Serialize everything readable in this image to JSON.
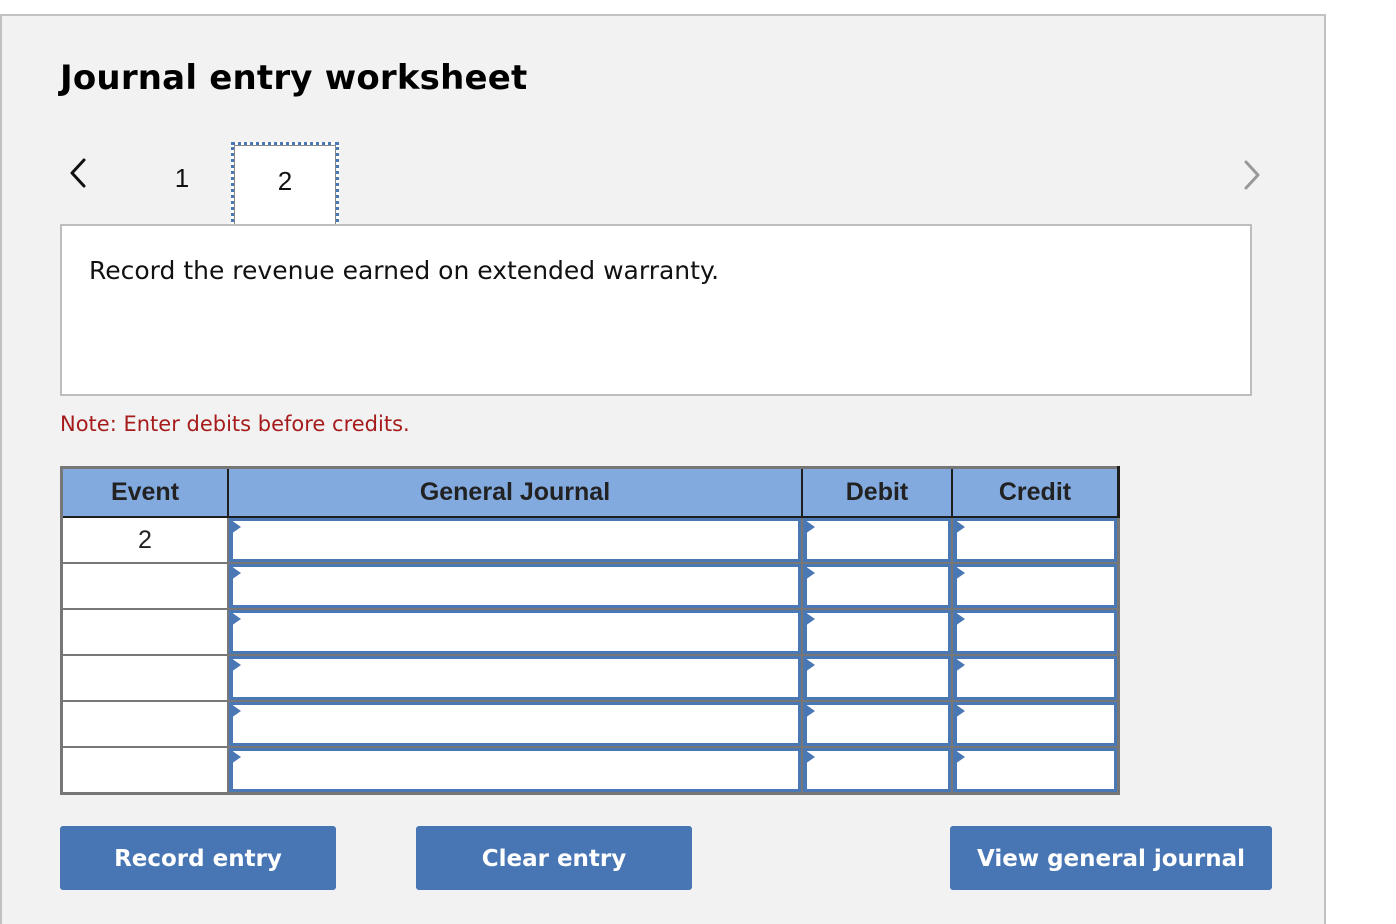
{
  "worksheet": {
    "title": "Journal entry worksheet",
    "nav": {
      "prev_icon": "chevron-left-icon",
      "next_icon": "chevron-right-icon",
      "pages": [
        {
          "label": "1",
          "active": false
        },
        {
          "label": "2",
          "active": true
        }
      ]
    },
    "instruction": "Record the revenue earned on extended warranty.",
    "note": "Note: Enter debits before credits.",
    "colors": {
      "header_fill": "#82aadf",
      "input_border": "#4a78b5",
      "button_fill": "#4875b4",
      "note_text": "#a61c1c"
    }
  },
  "table": {
    "columns": [
      "Event",
      "General Journal",
      "Debit",
      "Credit"
    ],
    "rows": [
      {
        "event": "2",
        "account": "",
        "debit": "",
        "credit": ""
      },
      {
        "event": "",
        "account": "",
        "debit": "",
        "credit": ""
      },
      {
        "event": "",
        "account": "",
        "debit": "",
        "credit": ""
      },
      {
        "event": "",
        "account": "",
        "debit": "",
        "credit": ""
      },
      {
        "event": "",
        "account": "",
        "debit": "",
        "credit": ""
      },
      {
        "event": "",
        "account": "",
        "debit": "",
        "credit": ""
      }
    ]
  },
  "buttons": {
    "record": "Record entry",
    "clear": "Clear entry",
    "view": "View general journal"
  }
}
